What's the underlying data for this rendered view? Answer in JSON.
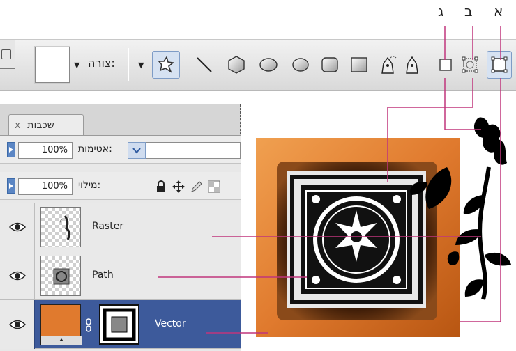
{
  "callouts": {
    "a": "א",
    "b": "ב",
    "c": "ג"
  },
  "toolbar": {
    "shape_label": "צורה:",
    "tools": [
      "custom-shape-tool",
      "line-tool",
      "polygon-tool",
      "ellipse-tool",
      "rounded-rectangle-tool",
      "rectangle-tool",
      "freeform-pen-tool",
      "pen-tool"
    ],
    "modes": [
      "fill-pixels-button",
      "paths-button",
      "shape-layers-button"
    ]
  },
  "layers_panel": {
    "tab_label": "שכבות",
    "close_label": "x",
    "opacity_label": "אטימות:",
    "opacity_value": "100%",
    "fill_label": "מילוי:",
    "fill_value": "100%",
    "layers": [
      {
        "name": "Raster"
      },
      {
        "name": "Path"
      },
      {
        "name": "Vector",
        "selected": true
      }
    ]
  },
  "colors": {
    "accent": "#3d5a9b",
    "callout_line": "#c0357c",
    "tile_orange": "#e07a2e"
  }
}
